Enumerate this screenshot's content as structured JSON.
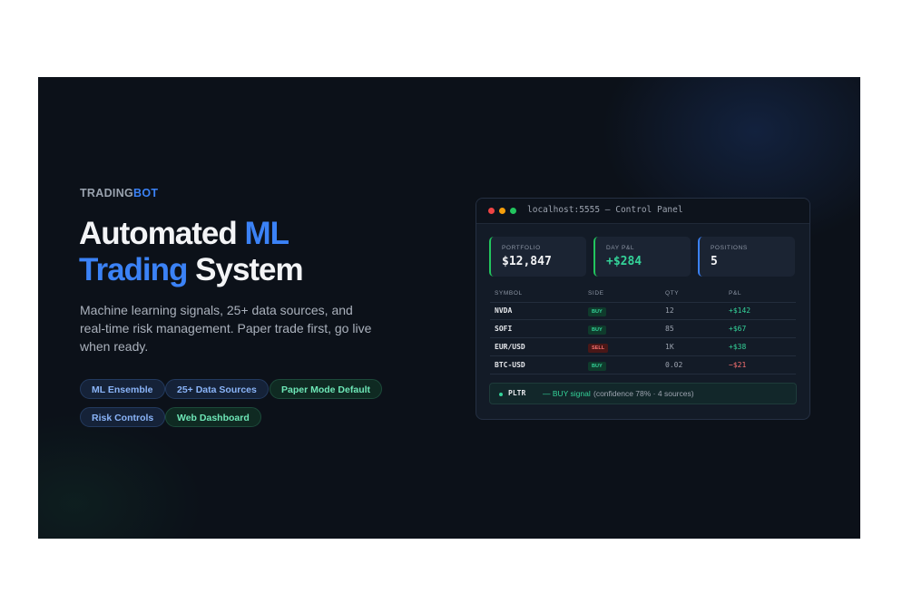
{
  "brand": {
    "part1": "TRADING",
    "part2": "BOT"
  },
  "headline": {
    "word1": "Automated ",
    "word2": "ML",
    "word3": "Trading",
    "word4": " System"
  },
  "subtitle": "Machine learning signals, 25+ data sources, and real-time risk management. Paper trade first, go live when ready.",
  "features": [
    {
      "label": "ML Ensemble",
      "style": "blue"
    },
    {
      "label": "25+ Data Sources",
      "style": "blue"
    },
    {
      "label": "Paper Mode Default",
      "style": "green"
    },
    {
      "label": "Risk Controls",
      "style": "blue"
    },
    {
      "label": "Web Dashboard",
      "style": "green"
    }
  ],
  "panel": {
    "window_title": "localhost:5555 — Control Panel",
    "window_dots": [
      "#ef4444",
      "#f59e0b",
      "#22c55e"
    ],
    "stats": [
      {
        "label": "PORTFOLIO",
        "value": "$12,847",
        "accent": "#22c55e",
        "value_color": "#f3f4f6"
      },
      {
        "label": "DAY P&L",
        "value": "+$284",
        "accent": "#22c55e",
        "value_color": "#34d399"
      },
      {
        "label": "POSITIONS",
        "value": "5",
        "accent": "#3b82f6",
        "value_color": "#f3f4f6"
      }
    ],
    "table": {
      "headers": {
        "symbol": "SYMBOL",
        "side": "SIDE",
        "qty": "QTY",
        "pnl": "P&L"
      },
      "rows": [
        {
          "symbol": "NVDA",
          "side": "BUY",
          "qty": "12",
          "pnl": "+$142"
        },
        {
          "symbol": "SOFI",
          "side": "BUY",
          "qty": "85",
          "pnl": "+$67"
        },
        {
          "symbol": "EUR/USD",
          "side": "SELL",
          "qty": "1K",
          "pnl": "+$38"
        },
        {
          "symbol": "BTC-USD",
          "side": "BUY",
          "qty": "0.02",
          "pnl": "−$21"
        }
      ],
      "positive_color": "#34d399",
      "negative_color": "#f87171"
    },
    "signal": {
      "symbol": "PLTR",
      "action": "— BUY signal",
      "detail": "(confidence 78% · 4 sources)"
    }
  }
}
